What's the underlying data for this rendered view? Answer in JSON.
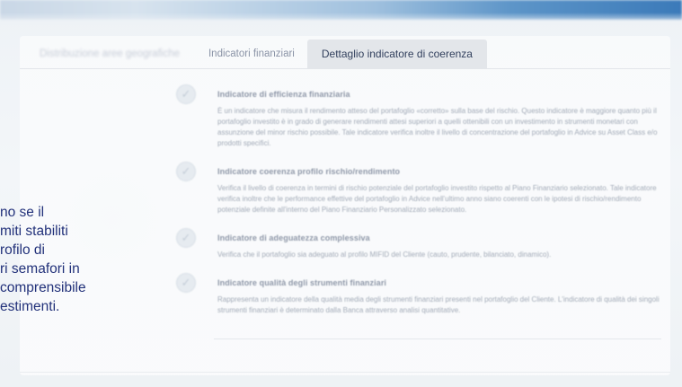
{
  "tabs": {
    "tab_1": "Distribuzione aree geografiche",
    "tab_2": "Indicatori finanziari",
    "tab_3": "Dettaglio indicatore di coerenza"
  },
  "indicators": [
    {
      "title": "Indicatore di efficienza finanziaria",
      "body": "È un indicatore che misura il rendimento atteso del portafoglio «corretto» sulla base del rischio. Questo indicatore è maggiore quanto più il portafoglio investito è in grado di generare rendimenti attesi superiori a quelli ottenibili con un investimento in strumenti monetari con assunzione del minor rischio possibile. Tale indicatore verifica inoltre il livello di concentrazione del portafoglio in Advice su Asset Class e/o prodotti specifici."
    },
    {
      "title": "Indicatore coerenza profilo rischio/rendimento",
      "body": "Verifica il livello di coerenza in termini di rischio potenziale del portafoglio investito rispetto al Piano Finanziario selezionato. Tale indicatore verifica inoltre che le performance effettive del portafoglio in Advice nell'ultimo anno siano coerenti con le ipotesi di rischio/rendimento potenziale definite all'interno del Piano Finanziario Personalizzato selezionato."
    },
    {
      "title": "Indicatore di adeguatezza complessiva",
      "body": "Verifica che il portafoglio sia adeguato al profilo MIFID del Cliente (cauto, prudente, bilanciato, dinamico)."
    },
    {
      "title": "Indicatore qualità degli strumenti finanziari",
      "body": "Rappresenta un indicatore della qualità media degli strumenti finanziari presenti nel portafoglio del Cliente. L'indicatore di qualità dei singoli strumenti finanziari è determinato dalla Banca attraverso analisi quantitative."
    }
  ],
  "side_text": {
    "line_1": "no se il",
    "line_2": "miti stabiliti",
    "line_3": "rofilo di",
    "line_4": "ri semafori in",
    "line_5": "comprensibile",
    "line_6": "estimenti."
  },
  "icons": {
    "indicator": "check-circle-icon"
  },
  "colors": {
    "side_text": "#22317a",
    "active_tab_bg": "#e3e6ea",
    "top_band_accent": "#3b7ab9"
  }
}
